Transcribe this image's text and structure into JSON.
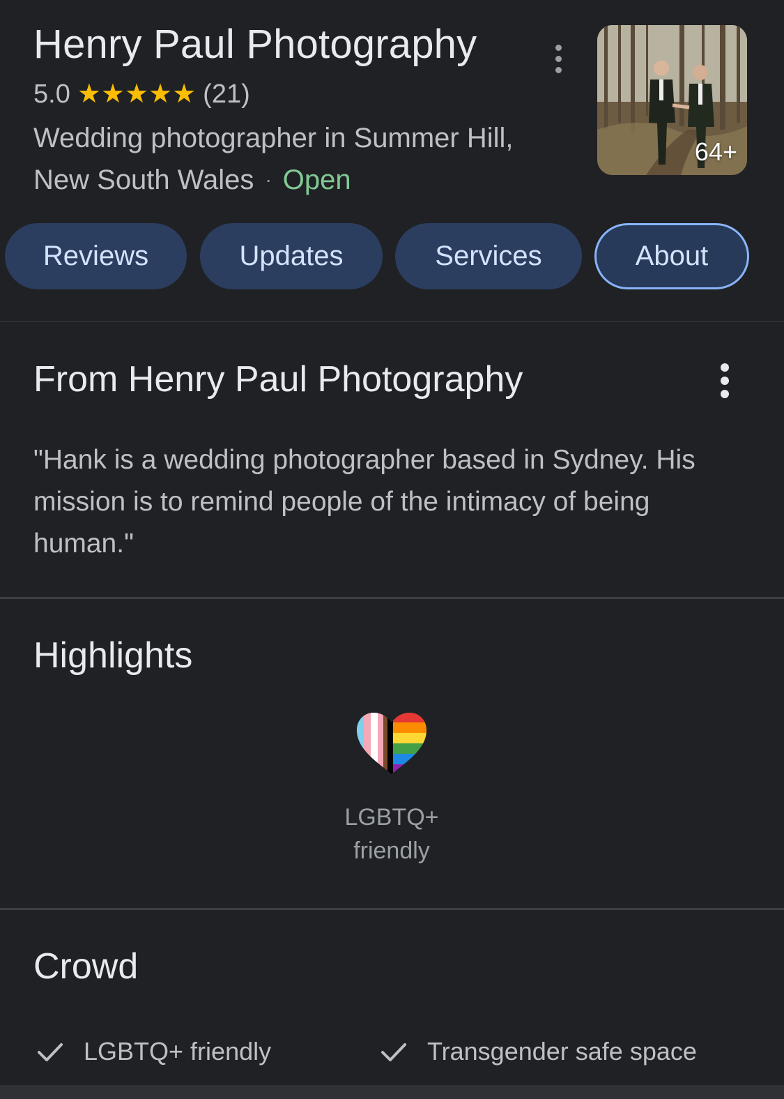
{
  "header": {
    "title": "Henry Paul Photography",
    "rating": "5.0",
    "stars": "★★★★★",
    "review_count": "(21)",
    "category": "Wedding photographer in Summer Hill, New South Wales",
    "separator": "·",
    "status": "Open",
    "photo_count": "64+",
    "more_icon": "more-vert-icon",
    "colors": {
      "star": "#fbbc04",
      "open": "#81c995"
    }
  },
  "tabs": [
    {
      "label": "Reviews",
      "active": false
    },
    {
      "label": "Updates",
      "active": false
    },
    {
      "label": "Services",
      "active": false
    },
    {
      "label": "About",
      "active": true
    }
  ],
  "from_section": {
    "title": "From Henry Paul Photography",
    "description": "\"Hank is a wedding photographer based in Sydney. His mission is to remind people of the intimacy of being human.\""
  },
  "highlights": {
    "title": "Highlights",
    "items": [
      {
        "label": "LGBTQ+ friendly",
        "icon": "progress-pride-heart-icon"
      }
    ]
  },
  "crowd": {
    "title": "Crowd",
    "items": [
      {
        "label": "LGBTQ+ friendly",
        "icon": "check-icon"
      },
      {
        "label": "Transgender safe space",
        "icon": "check-icon"
      }
    ]
  }
}
